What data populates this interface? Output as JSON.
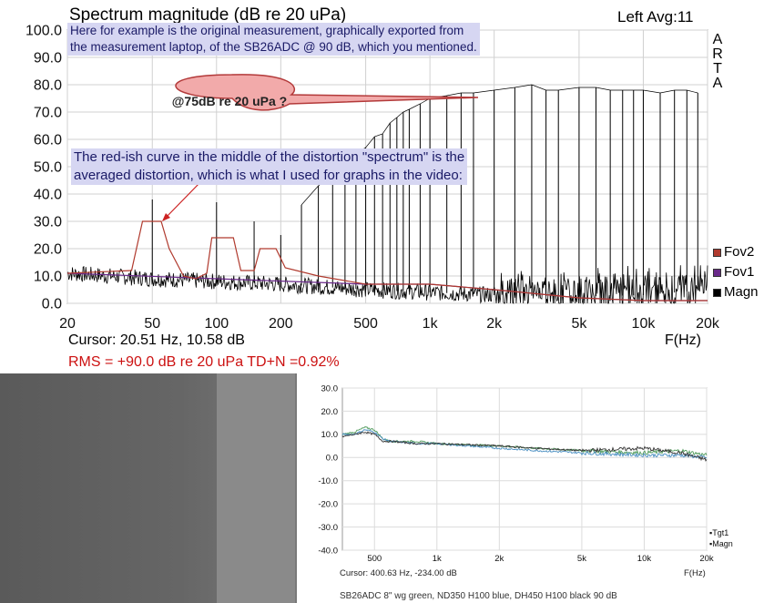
{
  "top": {
    "title": "Spectrum magnitude (dB re 20 uPa)",
    "header_right": "Left  Avg:11",
    "brand": [
      "A",
      "R",
      "T",
      "A"
    ],
    "note1": [
      "Here for example is the original measurement, graphically exported from",
      "the measurement laptop, of the SB26ADC @ 90 dB, which you mentioned."
    ],
    "callout": "@75dB re 20 uPa ?",
    "note2": [
      "The red-ish curve in the middle of the distortion \"spectrum\" is the",
      "averaged distortion, which is what I used for graphs in the video:"
    ],
    "cursor": "Cursor: 20.51 Hz, 10.58 dB",
    "xlabel": "F(Hz)",
    "rms": "RMS =  +90.0 dB re 20 uPa  TD+N =0.92%",
    "legend": [
      {
        "label": "Fov2",
        "color": "#b03a2e"
      },
      {
        "label": "Fov1",
        "color": "#6a2a8a"
      },
      {
        "label": "Magn",
        "color": "#000000"
      }
    ]
  },
  "bottom": {
    "cursor": "Cursor: 400.63 Hz, -234.00 dB",
    "xlabel": "F(Hz)",
    "caption": "SB26ADC 8\" wg green, ND350 H100 blue, DH450 H100 black 90 dB",
    "legend": [
      {
        "label": "Tgt1",
        "color": "#000000"
      },
      {
        "label": "Magn",
        "color": "#000000"
      }
    ]
  },
  "chart_data": [
    {
      "type": "line",
      "title": "Spectrum magnitude (dB re 20 uPa)",
      "xlabel": "F(Hz)",
      "ylabel": "",
      "xscale": "log",
      "xlim": [
        20,
        20000
      ],
      "ylim": [
        0,
        100
      ],
      "x_ticks": [
        20,
        50,
        100,
        200,
        500,
        1000,
        2000,
        5000,
        10000,
        20000
      ],
      "x_tick_labels": [
        "20",
        "50",
        "100",
        "200",
        "500",
        "1k",
        "2k",
        "5k",
        "10k",
        "20k"
      ],
      "y_ticks": [
        0,
        10,
        20,
        30,
        40,
        50,
        60,
        70,
        80,
        90,
        100
      ],
      "y_tick_labels": [
        "0.0",
        "10.0",
        "20.0",
        "30.0",
        "40.0",
        "50.0",
        "60.0",
        "70.0",
        "80.0",
        "90.0",
        "100.0"
      ],
      "grid": true,
      "legend_position": "right",
      "series": [
        {
          "name": "Magn",
          "color": "#000000",
          "style": "harmonic-peaks",
          "noise_floor": [
            [
              20,
              11
            ],
            [
              50,
              9
            ],
            [
              100,
              8
            ],
            [
              200,
              7
            ],
            [
              500,
              5
            ],
            [
              1000,
              4
            ],
            [
              2000,
              3
            ],
            [
              5000,
              2.5
            ],
            [
              10000,
              3
            ],
            [
              20000,
              5
            ]
          ],
          "peaks": [
            [
              50,
              38
            ],
            [
              100,
              37
            ],
            [
              150,
              30
            ],
            [
              200,
              25
            ],
            [
              250,
              36
            ],
            [
              300,
              43
            ],
            [
              350,
              47
            ],
            [
              400,
              50
            ],
            [
              450,
              55
            ],
            [
              500,
              57
            ],
            [
              550,
              61
            ],
            [
              600,
              62
            ],
            [
              650,
              66
            ],
            [
              700,
              68
            ],
            [
              750,
              70
            ],
            [
              800,
              71
            ],
            [
              900,
              73
            ],
            [
              1000,
              75
            ],
            [
              1200,
              76
            ],
            [
              1400,
              77
            ],
            [
              1600,
              77
            ],
            [
              2000,
              78
            ],
            [
              2500,
              79
            ],
            [
              3000,
              80
            ],
            [
              3500,
              78
            ],
            [
              4000,
              78
            ],
            [
              5000,
              79
            ],
            [
              6000,
              79
            ],
            [
              7000,
              78
            ],
            [
              8000,
              78
            ],
            [
              9000,
              78
            ],
            [
              10000,
              78
            ],
            [
              12000,
              77
            ],
            [
              14000,
              78
            ],
            [
              16000,
              78
            ],
            [
              18000,
              77
            ]
          ]
        },
        {
          "name": "Fov1",
          "color": "#6a2a8a",
          "style": "line",
          "points": [
            [
              20,
              11
            ],
            [
              500,
              7
            ],
            [
              1000,
              7
            ],
            [
              2000,
              5
            ],
            [
              5000,
              2
            ],
            [
              10000,
              1
            ],
            [
              20000,
              1
            ]
          ]
        },
        {
          "name": "Fov2",
          "color": "#b03a2e",
          "style": "line",
          "points": [
            [
              20,
              11
            ],
            [
              40,
              12
            ],
            [
              45,
              30
            ],
            [
              55,
              30
            ],
            [
              60,
              20
            ],
            [
              70,
              10
            ],
            [
              80,
              9
            ],
            [
              90,
              11
            ],
            [
              95,
              24
            ],
            [
              120,
              24
            ],
            [
              130,
              12
            ],
            [
              150,
              12
            ],
            [
              160,
              20
            ],
            [
              190,
              20
            ],
            [
              210,
              13
            ],
            [
              300,
              10
            ],
            [
              500,
              7
            ],
            [
              1000,
              7
            ],
            [
              2000,
              5
            ],
            [
              5000,
              2
            ],
            [
              10000,
              1
            ],
            [
              20000,
              1
            ]
          ]
        }
      ]
    },
    {
      "type": "line",
      "xlabel": "F(Hz)",
      "xscale": "log",
      "xlim": [
        350,
        20000
      ],
      "ylim": [
        -40,
        30
      ],
      "x_ticks": [
        500,
        1000,
        2000,
        5000,
        10000,
        20000
      ],
      "x_tick_labels": [
        "500",
        "1k",
        "2k",
        "5k",
        "10k",
        "20k"
      ],
      "y_ticks": [
        -40,
        -30,
        -20,
        -10,
        0,
        10,
        20,
        30
      ],
      "y_tick_labels": [
        "-40.0",
        "-30.0",
        "-20.0",
        "-10.0",
        "0.0",
        "10.0",
        "20.0",
        "30.0"
      ],
      "grid": true,
      "legend_position": "right",
      "series": [
        {
          "color": "#4e9a5a",
          "points": [
            [
              350,
              10
            ],
            [
              400,
              11
            ],
            [
              450,
              13
            ],
            [
              500,
              12
            ],
            [
              550,
              8
            ],
            [
              600,
              7
            ],
            [
              800,
              7
            ],
            [
              1000,
              6
            ],
            [
              2000,
              5
            ],
            [
              3000,
              4
            ],
            [
              5000,
              3
            ],
            [
              10000,
              2
            ],
            [
              15000,
              3
            ],
            [
              20000,
              1
            ]
          ]
        },
        {
          "color": "#4a8fc2",
          "points": [
            [
              350,
              10
            ],
            [
              400,
              10
            ],
            [
              450,
              12
            ],
            [
              500,
              11
            ],
            [
              550,
              8
            ],
            [
              600,
              7
            ],
            [
              800,
              6
            ],
            [
              1000,
              6
            ],
            [
              2000,
              4
            ],
            [
              3000,
              3
            ],
            [
              5000,
              2
            ],
            [
              10000,
              1
            ],
            [
              15000,
              1
            ],
            [
              20000,
              0
            ]
          ]
        },
        {
          "color": "#333333",
          "points": [
            [
              350,
              9
            ],
            [
              400,
              10
            ],
            [
              450,
              11
            ],
            [
              500,
              10
            ],
            [
              550,
              7
            ],
            [
              600,
              7
            ],
            [
              800,
              6
            ],
            [
              1000,
              6
            ],
            [
              2000,
              5
            ],
            [
              3000,
              4
            ],
            [
              5000,
              3
            ],
            [
              10000,
              4
            ],
            [
              15000,
              2
            ],
            [
              20000,
              -1
            ]
          ]
        }
      ]
    }
  ]
}
